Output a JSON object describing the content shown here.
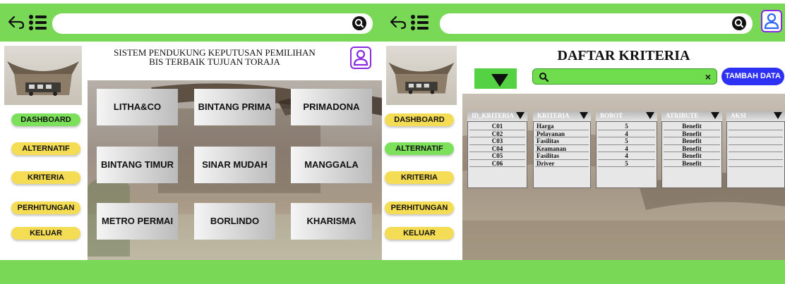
{
  "colors": {
    "green_bar": "#79d957",
    "nav_active": "#7ce05a",
    "nav_inactive": "#f5dc55",
    "primary_button": "#2c31f3"
  },
  "left_screen": {
    "header_title_line1": "SISTEM PENDUKUNG KEPUTUSAN PEMILIHAN",
    "header_title_line2": "BIS TERBAIK  TUJUAN TORAJA",
    "sidebar": [
      {
        "label": "DASHBOARD",
        "active": true
      },
      {
        "label": "ALTERNATIF",
        "active": false
      },
      {
        "label": "KRITERIA",
        "active": false
      },
      {
        "label": "PERHITUNGAN",
        "active": false
      },
      {
        "label": "KELUAR",
        "active": false
      }
    ],
    "cards": [
      "LITHA&CO",
      "BINTANG PRIMA",
      "PRIMADONA",
      "BINTANG TIMUR",
      "SINAR MUDAH",
      "MANGGALA",
      "METRO PERMAI",
      "BORLINDO",
      "KHARISMA"
    ]
  },
  "right_screen": {
    "title": "DAFTAR KRITERIA",
    "search_placeholder": "",
    "add_button": "TAMBAH DATA",
    "clear_glyph": "×",
    "sidebar": [
      {
        "label": "DASHBOARD",
        "active": false
      },
      {
        "label": "ALTERNATIF",
        "active": true
      },
      {
        "label": "KRITERIA",
        "active": false
      },
      {
        "label": "PERHITUNGAN",
        "active": false
      },
      {
        "label": "KELUAR",
        "active": false
      }
    ],
    "table": {
      "headers": [
        "ID_KRITERIA",
        "KRITERIA",
        "BOBOT",
        "ATRIBUTE",
        "AKSI"
      ],
      "rows": [
        [
          "C01",
          "Harga",
          "5",
          "Benefit",
          ""
        ],
        [
          "C02",
          "Pelayanan",
          "4",
          "Benefit",
          ""
        ],
        [
          "C03",
          "Fasilitas",
          "5",
          "Benefit",
          ""
        ],
        [
          "C04",
          "Keamanan",
          "4",
          "Benefit",
          ""
        ],
        [
          "C05",
          "Fasilitas",
          "4",
          "Benefit",
          ""
        ],
        [
          "C06",
          "Driver",
          "5",
          "Benefit",
          ""
        ]
      ]
    }
  }
}
